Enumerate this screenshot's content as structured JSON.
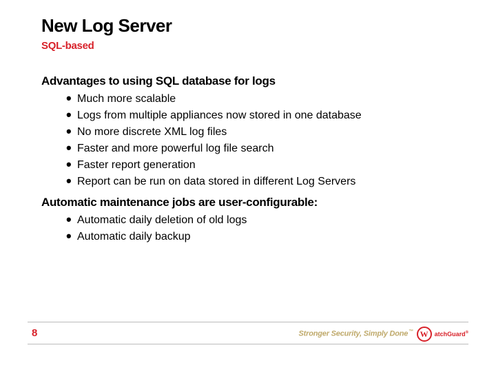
{
  "title": "New Log Server",
  "subtitle": "SQL-based",
  "sections": [
    {
      "heading": "Advantages to using SQL database for logs",
      "bullets": [
        "Much more scalable",
        "Logs from multiple appliances now stored in one database",
        "No more discrete XML log files",
        "Faster and more powerful log file search",
        "Faster report generation",
        "Report can be run on data stored in different Log Servers"
      ]
    },
    {
      "heading": "Automatic maintenance jobs are user-configurable:",
      "bullets": [
        "Automatic daily deletion of old logs",
        "Automatic daily backup"
      ]
    }
  ],
  "page_number": "8",
  "tagline": "Stronger Security, Simply Done",
  "tagline_tm": "™",
  "logo": {
    "initial": "W",
    "name": "atchGuard",
    "reg": "®"
  }
}
